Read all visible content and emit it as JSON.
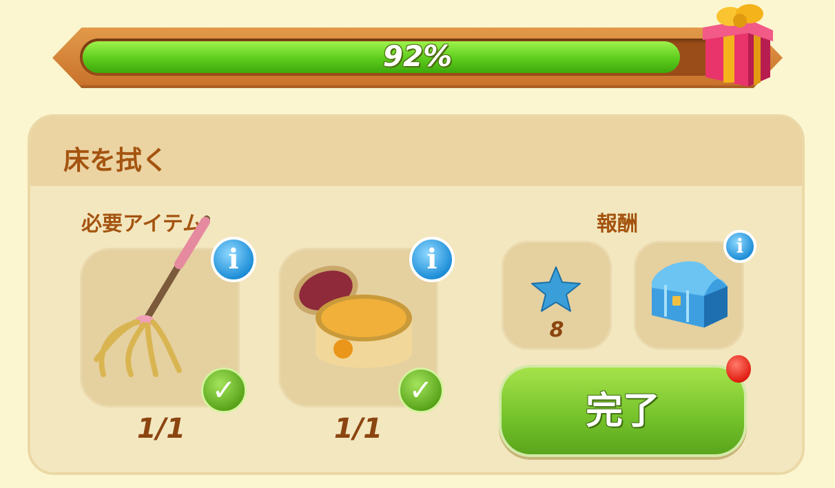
{
  "progress": {
    "percent_label": "92%",
    "value": 0.92
  },
  "task": {
    "title": "床を拭く"
  },
  "required": {
    "label": "必要アイテム",
    "items": [
      {
        "name": "mop",
        "count": "1/1"
      },
      {
        "name": "polishing-wax",
        "count": "1/1"
      }
    ]
  },
  "reward": {
    "label": "報酬",
    "star_count": "8"
  },
  "buttons": {
    "complete": "完了"
  },
  "colors": {
    "accent_green": "#73c12a",
    "title_brown": "#a45410",
    "info_blue": "#1f8fd8"
  }
}
